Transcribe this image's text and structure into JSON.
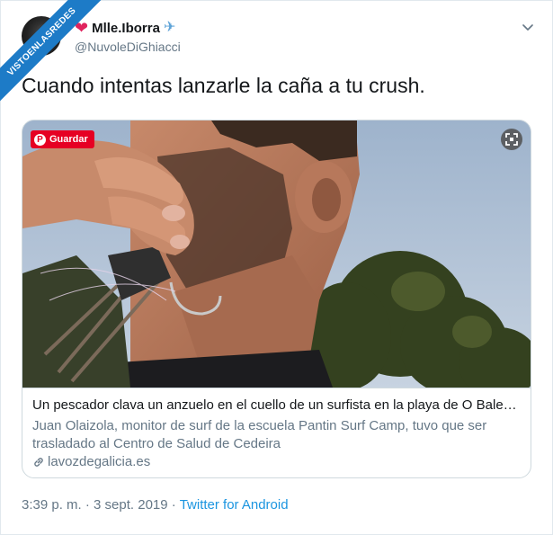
{
  "watermark": "VISTOENLASREDES",
  "user": {
    "display_name": "Mlle.Iborra",
    "handle": "@NuvoleDiGhiacci",
    "heart": "❤",
    "plane": "✈"
  },
  "tweet": {
    "text": "Cuando intentas lanzarle la caña a tu crush."
  },
  "card": {
    "pin_label": "Guardar",
    "title": "Un pescador clava un anzuelo en el cuello de un surfista en la playa de O Bale…",
    "description": "Juan Olaizola, monitor de surf de la escuela Pantin Surf Camp, tuvo que ser trasladado al Centro de Salud de Cedeira",
    "domain": "lavozdegalicia.es"
  },
  "meta": {
    "time": "3:39 p. m.",
    "sep1": " · ",
    "date": "3 sept. 2019",
    "sep2": " · ",
    "source": "Twitter for Android"
  },
  "icons": {
    "chevron": "chevron-down-icon",
    "expand": "expand-icon",
    "link": "link-icon",
    "pinterest": "pinterest-icon"
  },
  "colors": {
    "link_blue": "#1b95e0",
    "pinterest_red": "#e60023",
    "heart_red": "#e0245e",
    "muted_text": "#657786",
    "watermark_blue": "#1d7bc7"
  }
}
